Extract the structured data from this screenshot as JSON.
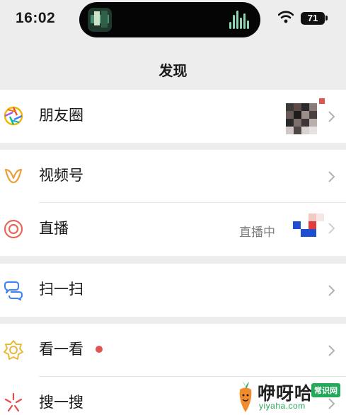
{
  "status_bar": {
    "time": "16:02",
    "battery": "71"
  },
  "nav": {
    "title": "发现"
  },
  "items": {
    "moments": {
      "label": "朋友圈",
      "icon": "moments-aperture-icon"
    },
    "channels": {
      "label": "视频号",
      "icon": "channels-butterfly-icon"
    },
    "live": {
      "label": "直播",
      "icon": "live-ring-icon",
      "status": "直播中"
    },
    "scan": {
      "label": "扫一扫",
      "icon": "scan-icon"
    },
    "top_stories": {
      "label": "看一看",
      "icon": "top-stories-icon"
    },
    "search": {
      "label": "搜一搜",
      "icon": "search-sparkle-icon"
    }
  },
  "watermark": {
    "name": "咿呀哈",
    "badge": "常识网",
    "url": "yiyaha.com"
  },
  "colors": {
    "background": "#ededed",
    "cell": "#ffffff",
    "badge_red": "#e0554f",
    "brand_green": "#26a85b"
  }
}
